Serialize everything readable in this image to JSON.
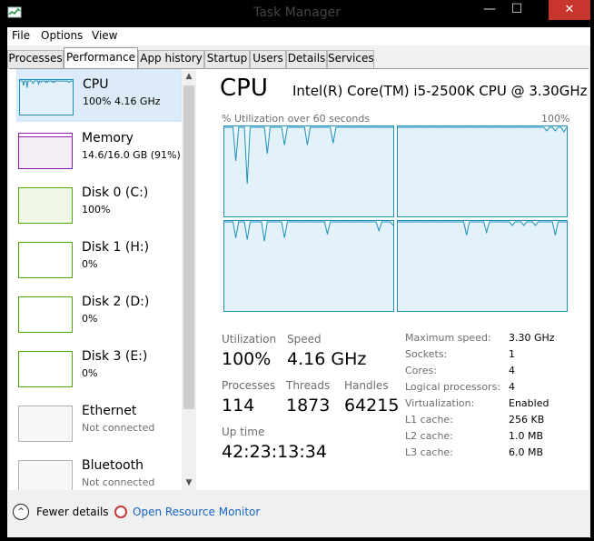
{
  "window": {
    "title": "Task Manager",
    "minimize_glyph": "—",
    "maximize_glyph": "☐",
    "close_glyph": "✕"
  },
  "menu": [
    "File",
    "Options",
    "View"
  ],
  "tabs": [
    "Processes",
    "Performance",
    "App history",
    "Startup",
    "Users",
    "Details",
    "Services"
  ],
  "active_tab": "Performance",
  "sidebar": [
    {
      "name": "CPU",
      "sub": "100%  4.16 GHz",
      "selected": true,
      "color": "#1e8fbd",
      "bg": "#f1f9fc"
    },
    {
      "name": "Memory",
      "sub": "14.6/16.0 GB (91%)",
      "color": "#8b1bad",
      "bg": "#f4eff6"
    },
    {
      "name": "Disk 0 (C:)",
      "sub": "100%",
      "color": "#4da60c",
      "bg": "#eff7e9"
    },
    {
      "name": "Disk 1 (H:)",
      "sub": "0%",
      "color": "#4da60c",
      "bg": "#ffffff"
    },
    {
      "name": "Disk 2 (D:)",
      "sub": "0%",
      "color": "#4da60c",
      "bg": "#ffffff"
    },
    {
      "name": "Disk 3 (E:)",
      "sub": "0%",
      "color": "#4da60c",
      "bg": "#ffffff"
    },
    {
      "name": "Ethernet",
      "sub": "Not connected",
      "color": "#b0b0b0",
      "bg": "#f7f7f7",
      "muted": true
    },
    {
      "name": "Bluetooth",
      "sub": "Not connected",
      "color": "#b0b0b0",
      "bg": "#f7f7f7",
      "muted": true
    }
  ],
  "cpu": {
    "heading": "CPU",
    "model": "Intel(R) Core(TM) i5-2500K CPU @ 3.30GHz",
    "graph_label": "% Utilization over 60 seconds",
    "graph_max": "100%",
    "graph_color": "#1e8fbd",
    "core_graphs": [
      {
        "core": 1,
        "samples": [
          100,
          100,
          100,
          100,
          62,
          100,
          100,
          100,
          36,
          100,
          100,
          100,
          100,
          100,
          100,
          70,
          100,
          100,
          100,
          100,
          100,
          80,
          100,
          100,
          100,
          100,
          100,
          100,
          100,
          80,
          100,
          100,
          100,
          100,
          100,
          100,
          100,
          100,
          82,
          100,
          100,
          100,
          100,
          100,
          100,
          100,
          100,
          100,
          100,
          100,
          100,
          100,
          100,
          100,
          100,
          100,
          100,
          100,
          100,
          100
        ]
      },
      {
        "core": 2,
        "samples": [
          100,
          100,
          100,
          100,
          100,
          100,
          100,
          100,
          100,
          100,
          100,
          100,
          100,
          100,
          100,
          100,
          100,
          100,
          100,
          100,
          100,
          100,
          100,
          100,
          100,
          100,
          100,
          100,
          100,
          100,
          100,
          100,
          100,
          100,
          100,
          100,
          100,
          100,
          100,
          100,
          100,
          100,
          100,
          100,
          100,
          100,
          100,
          100,
          100,
          100,
          100,
          100,
          96,
          100,
          100,
          96,
          100,
          100,
          95,
          100
        ]
      },
      {
        "core": 3,
        "samples": [
          100,
          100,
          100,
          100,
          82,
          100,
          100,
          100,
          80,
          100,
          100,
          100,
          100,
          100,
          78,
          100,
          100,
          100,
          100,
          100,
          100,
          82,
          100,
          100,
          100,
          100,
          100,
          100,
          100,
          100,
          100,
          100,
          100,
          100,
          100,
          100,
          86,
          100,
          100,
          100,
          100,
          100,
          100,
          100,
          100,
          100,
          100,
          100,
          100,
          100,
          100,
          100,
          100,
          100,
          90,
          100,
          100,
          100,
          100,
          96
        ]
      },
      {
        "core": 4,
        "samples": [
          100,
          100,
          100,
          100,
          100,
          100,
          100,
          100,
          100,
          100,
          100,
          100,
          100,
          100,
          100,
          100,
          100,
          100,
          100,
          100,
          100,
          100,
          100,
          100,
          85,
          100,
          100,
          100,
          100,
          100,
          100,
          88,
          100,
          100,
          100,
          100,
          100,
          100,
          100,
          100,
          96,
          100,
          100,
          100,
          96,
          100,
          100,
          100,
          96,
          100,
          100,
          100,
          100,
          100,
          100,
          85,
          100,
          100,
          100,
          100
        ]
      }
    ],
    "stats": {
      "utilization_label": "Utilization",
      "utilization": "100%",
      "speed_label": "Speed",
      "speed": "4.16 GHz",
      "processes_label": "Processes",
      "processes": "114",
      "threads_label": "Threads",
      "threads": "1873",
      "handles_label": "Handles",
      "handles": "64215",
      "uptime_label": "Up time",
      "uptime": "42:23:13:34"
    },
    "specs": [
      {
        "label": "Maximum speed:",
        "value": "3.30 GHz"
      },
      {
        "label": "Sockets:",
        "value": "1"
      },
      {
        "label": "Cores:",
        "value": "4"
      },
      {
        "label": "Logical processors:",
        "value": "4"
      },
      {
        "label": "Virtualization:",
        "value": "Enabled"
      },
      {
        "label": "L1 cache:",
        "value": "256 KB"
      },
      {
        "label": "L2 cache:",
        "value": "1.0 MB"
      },
      {
        "label": "L3 cache:",
        "value": "6.0 MB"
      }
    ]
  },
  "footer": {
    "fewer_details": "Fewer details",
    "fewer_glyph": "^",
    "resource_monitor": "Open Resource Monitor"
  },
  "scroll": {
    "up_glyph": "▲",
    "down_glyph": "▼"
  }
}
